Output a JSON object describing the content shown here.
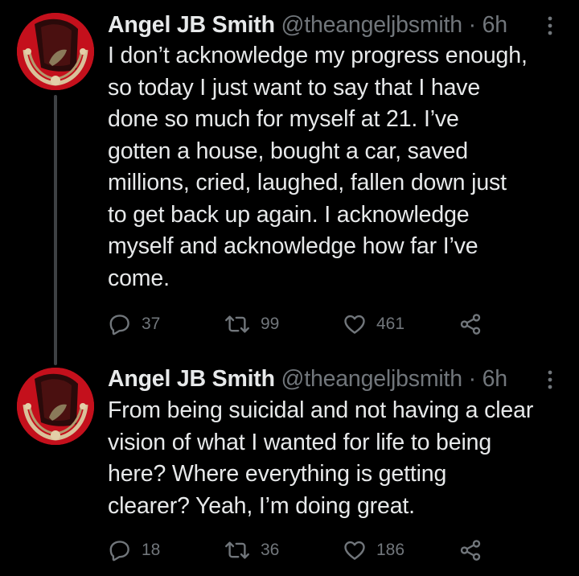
{
  "colors": {
    "background": "#000000",
    "text_primary": "#e7e9ea",
    "text_secondary": "#71767b",
    "avatar_red": "#c4101c",
    "thread_line": "#3e4144"
  },
  "icons": {
    "reply": "reply-icon",
    "retweet": "retweet-icon",
    "like": "heart-icon",
    "share": "share-icon",
    "more": "more-vertical-icon"
  },
  "tweets": [
    {
      "display_name": "Angel JB Smith",
      "handle": "@theangeljbsmith",
      "separator": "·",
      "time": "6h",
      "lines": [
        "I don’t acknowledge my progress enough,",
        "so today I just want to say that I have",
        "done so much for myself at 21. I’ve",
        "gotten a house, bought a car, saved",
        "millions, cried, laughed, fallen down just",
        "to get back up again. I acknowledge",
        "myself and acknowledge how far I’ve",
        "come."
      ],
      "replies": "37",
      "retweets": "99",
      "likes": "461"
    },
    {
      "display_name": "Angel JB Smith",
      "handle": "@theangeljbsmith",
      "separator": "·",
      "time": "6h",
      "lines": [
        "From being suicidal and not having a clear",
        "vision of what I wanted for life to being",
        "here? Where everything is getting",
        "clearer? Yeah, I’m doing great."
      ],
      "replies": "18",
      "retweets": "36",
      "likes": "186"
    }
  ]
}
